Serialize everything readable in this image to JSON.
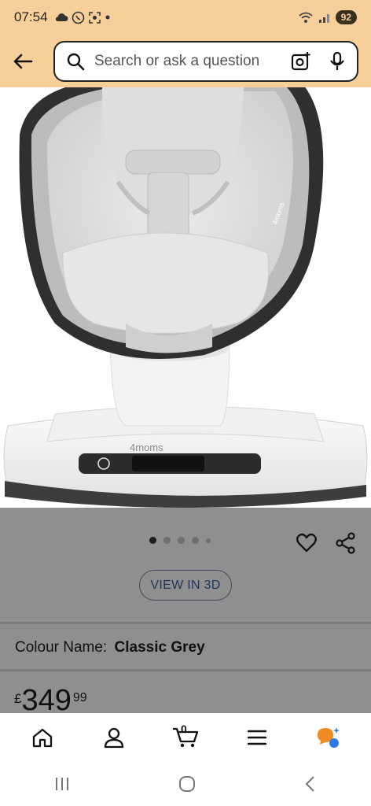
{
  "status_bar": {
    "time": "07:54",
    "battery": "92",
    "icons": [
      "cloud-icon",
      "whatsapp-icon",
      "screenshot-icon",
      "dot-icon",
      "wifi-icon",
      "signal-icon"
    ]
  },
  "search": {
    "placeholder": "Search or ask a question",
    "icons": [
      "back-arrow-icon",
      "search-icon",
      "camera-icon",
      "microphone-icon"
    ]
  },
  "product": {
    "image_alt": "4moms baby swing",
    "brand_mark": "4moms",
    "image_dots_count": 5,
    "active_dot": 0,
    "view_3d_label": "VIEW IN 3D",
    "colour_label": "Colour Name:",
    "colour_value": "Classic Grey",
    "price_currency": "£",
    "price_whole": "349",
    "price_fraction": "99"
  },
  "bottom_nav": {
    "items": [
      "home-icon",
      "account-icon",
      "cart-icon",
      "menu-icon",
      "rufus-icon"
    ],
    "cart_count": "0"
  },
  "colors": {
    "header_bg": "#f7cf9a",
    "panel_bg": "#8f8f8f",
    "accent_orange": "#f08a24",
    "accent_blue": "#2c7be5"
  }
}
